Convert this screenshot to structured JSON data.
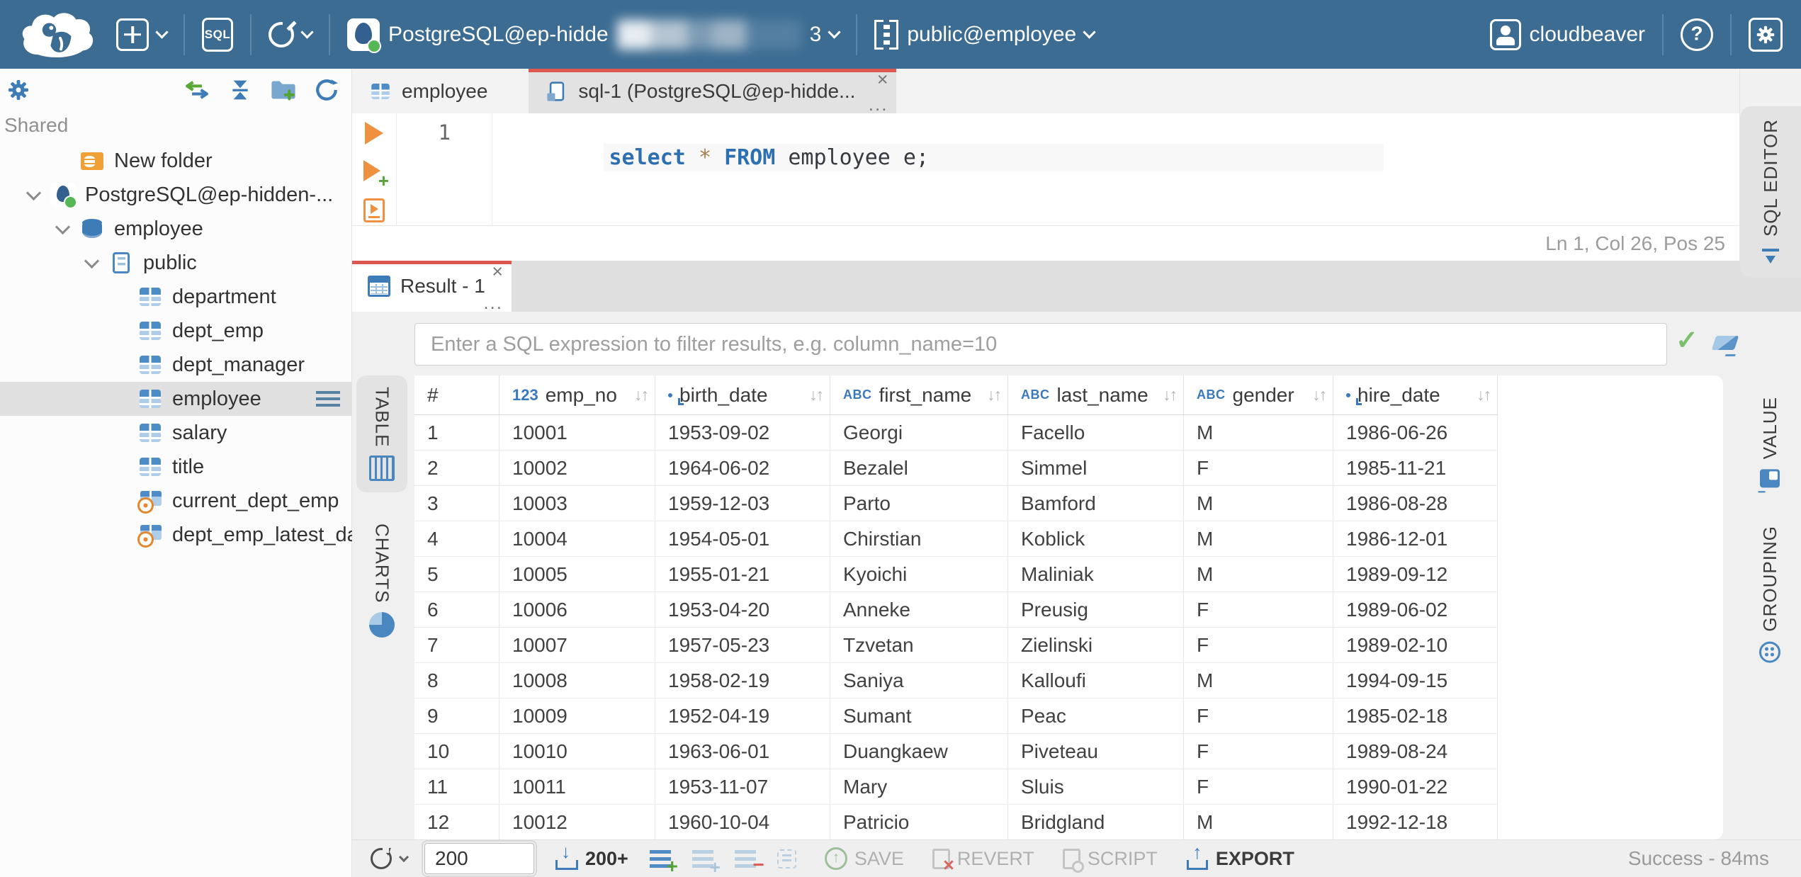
{
  "topbar": {
    "sql_badge": "SQL",
    "connection": {
      "name": "PostgreSQL@ep-hidde",
      "suffix": "3"
    },
    "schema": "public@employee",
    "user": "cloudbeaver"
  },
  "sidebar": {
    "section": "Shared",
    "tree": [
      {
        "label": "New folder",
        "icon": "ic-folder",
        "depth": 1,
        "chevron": false,
        "selected": false,
        "row_cls": ""
      },
      {
        "label": "PostgreSQL@ep-hidden-...",
        "icon": "ic-pg",
        "depth": 0,
        "chevron": true,
        "selected": false,
        "row_cls": ""
      },
      {
        "label": "employee",
        "icon": "ic-db",
        "depth": 1,
        "chevron": true,
        "selected": false,
        "row_cls": ""
      },
      {
        "label": "public",
        "icon": "ic-schema",
        "depth": 2,
        "chevron": true,
        "selected": false,
        "row_cls": ""
      },
      {
        "label": "department",
        "icon": "ic-table",
        "depth": 3,
        "chevron": false,
        "selected": false,
        "row_cls": ""
      },
      {
        "label": "dept_emp",
        "icon": "ic-table",
        "depth": 3,
        "chevron": false,
        "selected": false,
        "row_cls": ""
      },
      {
        "label": "dept_manager",
        "icon": "ic-table",
        "depth": 3,
        "chevron": false,
        "selected": false,
        "row_cls": ""
      },
      {
        "label": "employee",
        "icon": "ic-table",
        "depth": 3,
        "chevron": false,
        "selected": true,
        "row_cls": "selected"
      },
      {
        "label": "salary",
        "icon": "ic-table",
        "depth": 3,
        "chevron": false,
        "selected": false,
        "row_cls": ""
      },
      {
        "label": "title",
        "icon": "ic-table",
        "depth": 3,
        "chevron": false,
        "selected": false,
        "row_cls": ""
      },
      {
        "label": "current_dept_emp",
        "icon": "ic-view",
        "depth": 3,
        "chevron": false,
        "selected": false,
        "row_cls": ""
      },
      {
        "label": "dept_emp_latest_date",
        "icon": "ic-view",
        "depth": 3,
        "chevron": false,
        "selected": false,
        "row_cls": ""
      }
    ]
  },
  "editor": {
    "tabs": [
      {
        "label": "employee",
        "icon": "ic-table",
        "cls": "",
        "closable": false,
        "more": ""
      },
      {
        "label": "sql-1 (PostgreSQL@ep-hidde...",
        "icon": "ic-tab-sql",
        "cls": "active",
        "closable": true,
        "more": "..."
      }
    ],
    "line_number": "1",
    "code": [
      {
        "cls": "tok-kw",
        "v": "select"
      },
      {
        "cls": "tok-plain",
        "v": " "
      },
      {
        "cls": "tok-star",
        "v": "*"
      },
      {
        "cls": "tok-plain",
        "v": " "
      },
      {
        "cls": "tok-kw",
        "v": "FROM"
      },
      {
        "cls": "tok-plain",
        "v": " employee e;"
      }
    ],
    "caret_status": "Ln 1, Col 26, Pos 25"
  },
  "result": {
    "tab": {
      "label": "Result - 1",
      "more": "..."
    },
    "filter_placeholder": "Enter a SQL expression to filter results, e.g. column_name=10",
    "view_tabs": [
      {
        "label": "TABLE",
        "icon": "ic-grid-cols",
        "cls": "active"
      },
      {
        "label": "CHARTS",
        "icon": "ic-pie",
        "cls": ""
      }
    ],
    "grid": {
      "columns": [
        {
          "label": "#",
          "icon": "",
          "sortable": false
        },
        {
          "label": "emp_no",
          "icon": "ic-123",
          "sortable": true
        },
        {
          "label": "birth_date",
          "icon": "ic-clock",
          "sortable": true
        },
        {
          "label": "first_name",
          "icon": "ic-abc",
          "sortable": true
        },
        {
          "label": "last_name",
          "icon": "ic-abc",
          "sortable": true
        },
        {
          "label": "gender",
          "icon": "ic-abc",
          "sortable": true
        },
        {
          "label": "hire_date",
          "icon": "ic-clock",
          "sortable": true
        }
      ],
      "rows": [
        [
          "1",
          "10001",
          "1953-09-02",
          "Georgi",
          "Facello",
          "M",
          "1986-06-26"
        ],
        [
          "2",
          "10002",
          "1964-06-02",
          "Bezalel",
          "Simmel",
          "F",
          "1985-11-21"
        ],
        [
          "3",
          "10003",
          "1959-12-03",
          "Parto",
          "Bamford",
          "M",
          "1986-08-28"
        ],
        [
          "4",
          "10004",
          "1954-05-01",
          "Chirstian",
          "Koblick",
          "M",
          "1986-12-01"
        ],
        [
          "5",
          "10005",
          "1955-01-21",
          "Kyoichi",
          "Maliniak",
          "M",
          "1989-09-12"
        ],
        [
          "6",
          "10006",
          "1953-04-20",
          "Anneke",
          "Preusig",
          "F",
          "1989-06-02"
        ],
        [
          "7",
          "10007",
          "1957-05-23",
          "Tzvetan",
          "Zielinski",
          "F",
          "1989-02-10"
        ],
        [
          "8",
          "10008",
          "1958-02-19",
          "Saniya",
          "Kalloufi",
          "M",
          "1994-09-15"
        ],
        [
          "9",
          "10009",
          "1952-04-19",
          "Sumant",
          "Peac",
          "F",
          "1985-02-18"
        ],
        [
          "10",
          "10010",
          "1963-06-01",
          "Duangkaew",
          "Piveteau",
          "F",
          "1989-08-24"
        ],
        [
          "11",
          "10011",
          "1953-11-07",
          "Mary",
          "Sluis",
          "F",
          "1990-01-22"
        ],
        [
          "12",
          "10012",
          "1960-10-04",
          "Patricio",
          "Bridgland",
          "M",
          "1992-12-18"
        ]
      ]
    },
    "toolbar": {
      "row_limit": "200",
      "fetch_label": "200+",
      "save": "SAVE",
      "revert": "REVERT",
      "script": "SCRIPT",
      "export": "EXPORT",
      "status": "Success - 84ms"
    }
  },
  "right_rail": {
    "tabs": [
      {
        "label": "SQL EDITOR",
        "icon": "ic-sqledit"
      },
      {
        "label": "VALUE",
        "icon": "ic-value"
      },
      {
        "label": "GROUPING",
        "icon": "ic-grouping"
      }
    ]
  }
}
